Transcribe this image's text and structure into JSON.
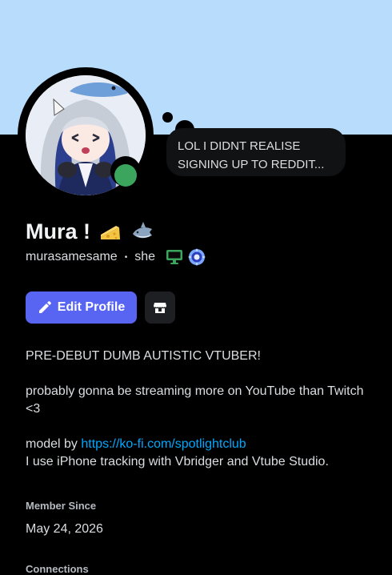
{
  "status_bubble": {
    "text": "LOL I DIDNT REALISE SIGNING UP TO REDDIT..."
  },
  "profile": {
    "display_name": "Mura !",
    "name_emojis": [
      "cheese-emoji",
      "shark-emoji"
    ],
    "username": "murasamesame",
    "separator": "•",
    "pronouns": "she",
    "badges": [
      "desktop-icon",
      "nitro-badge-icon"
    ],
    "status": "online",
    "status_color": "#3ba55d"
  },
  "actions": {
    "edit_profile_label": "Edit Profile",
    "shop_icon": "shop-icon"
  },
  "bio": {
    "line1": "PRE-DEBUT DUMB AUTISTIC VTUBER!",
    "line2": "probably gonna be streaming more on YouTube than Twitch <3",
    "model_prefix": "model by",
    "model_link": "https://ko-fi.com/spotlightclub",
    "line4": "I use iPhone tracking with Vbridger and Vtube Studio."
  },
  "member_since": {
    "label": "Member Since",
    "date": "May 24, 2026"
  },
  "connections": {
    "label": "Connections"
  },
  "colors": {
    "banner": "#b7dcfc",
    "accent": "#5865f2",
    "link": "#00a8fc",
    "background": "#000000"
  }
}
